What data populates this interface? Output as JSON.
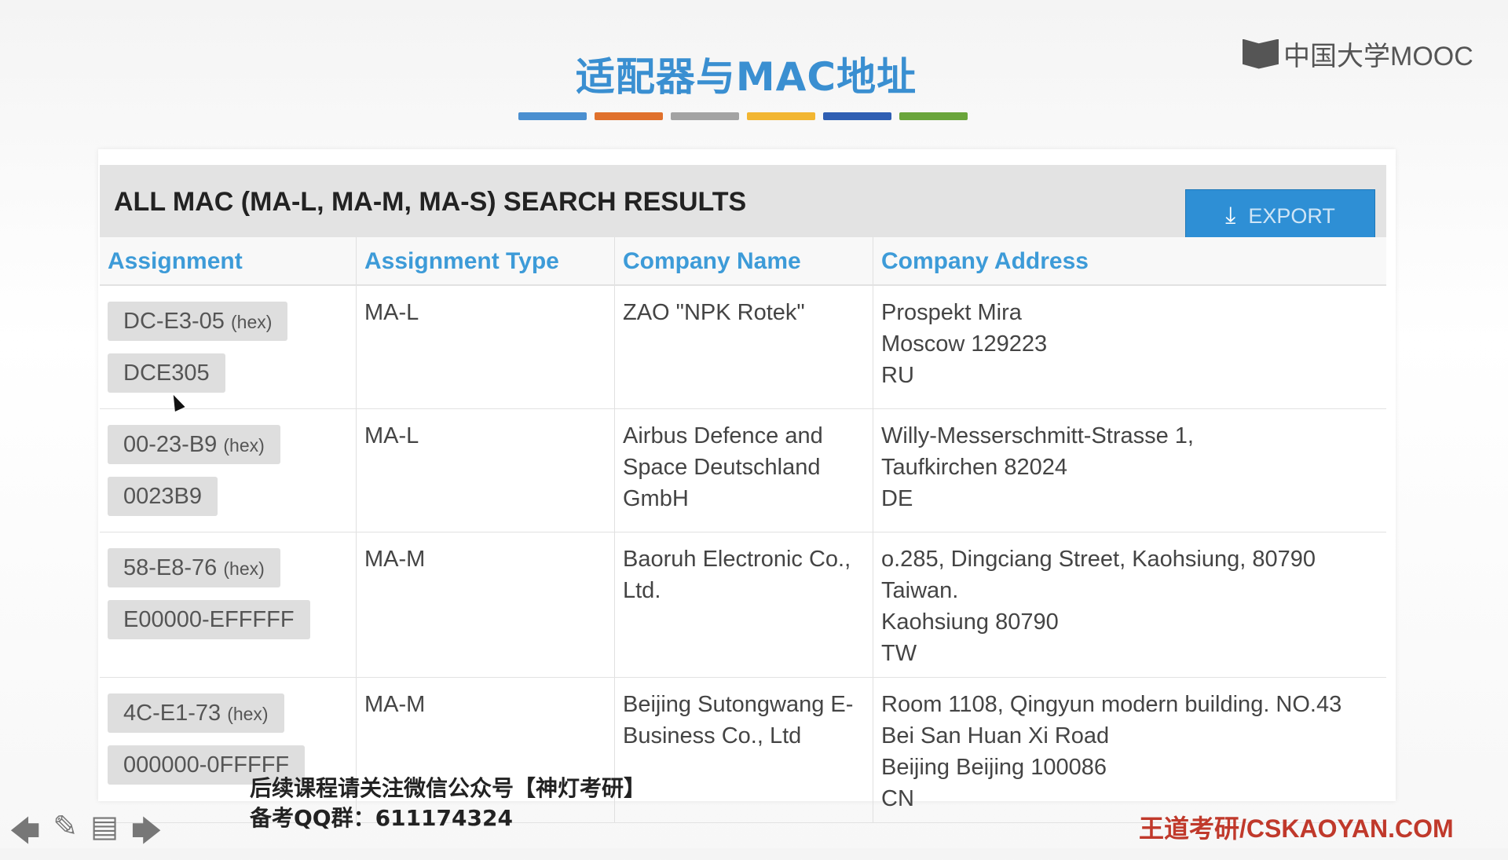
{
  "slide": {
    "title": "适配器与MAC地址",
    "logo_text": "中国大学MOOC",
    "color_bar": [
      "#4a8fd0",
      "#e0712c",
      "#a3a3a3",
      "#f2b632",
      "#2f5fb3",
      "#6aa53b"
    ]
  },
  "panel": {
    "header_title": "ALL MAC (MA-L, MA-M, MA-S) SEARCH RESULTS",
    "export_label": "EXPORT",
    "columns": [
      "Assignment",
      "Assignment Type",
      "Company Name",
      "Company Address"
    ],
    "rows": [
      {
        "hex": "DC-E3-05",
        "hex_suffix": "(hex)",
        "base": "DCE305",
        "type": "MA-L",
        "company_lines": [
          "ZAO \"NPK Rotek\""
        ],
        "address_lines": [
          "Prospekt Mira",
          "Moscow 129223",
          "RU"
        ]
      },
      {
        "hex": "00-23-B9",
        "hex_suffix": "(hex)",
        "base": "0023B9",
        "type": "MA-L",
        "company_lines": [
          "Airbus Defence and",
          "Space Deutschland",
          "GmbH"
        ],
        "address_lines": [
          "Willy-Messerschmitt-Strasse 1,",
          "Taufkirchen 82024",
          "DE"
        ]
      },
      {
        "hex": "58-E8-76",
        "hex_suffix": "(hex)",
        "base": "E00000-EFFFFF",
        "type": "MA-M",
        "company_lines": [
          "Baoruh Electronic Co.,",
          "Ltd."
        ],
        "address_lines": [
          "o.285, Dingciang Street, Kaohsiung, 80790",
          "Taiwan.",
          "Kaohsiung 80790",
          "TW"
        ]
      },
      {
        "hex": "4C-E1-73",
        "hex_suffix": "(hex)",
        "base": "000000-0FFFFF",
        "type": "MA-M",
        "company_lines": [
          "Beijing Sutongwang E-",
          "Business Co., Ltd"
        ],
        "address_lines": [
          "Room 1108, Qingyun modern building. NO.43",
          "Bei San Huan Xi Road",
          "Beijing Beijing 100086",
          "CN"
        ]
      }
    ]
  },
  "footer": {
    "notice_line1": "后续课程请关注微信公众号【神灯考研】",
    "notice_line2": "备考QQ群：611174324",
    "brand": "王道考研/CSKAOYAN.COM"
  }
}
